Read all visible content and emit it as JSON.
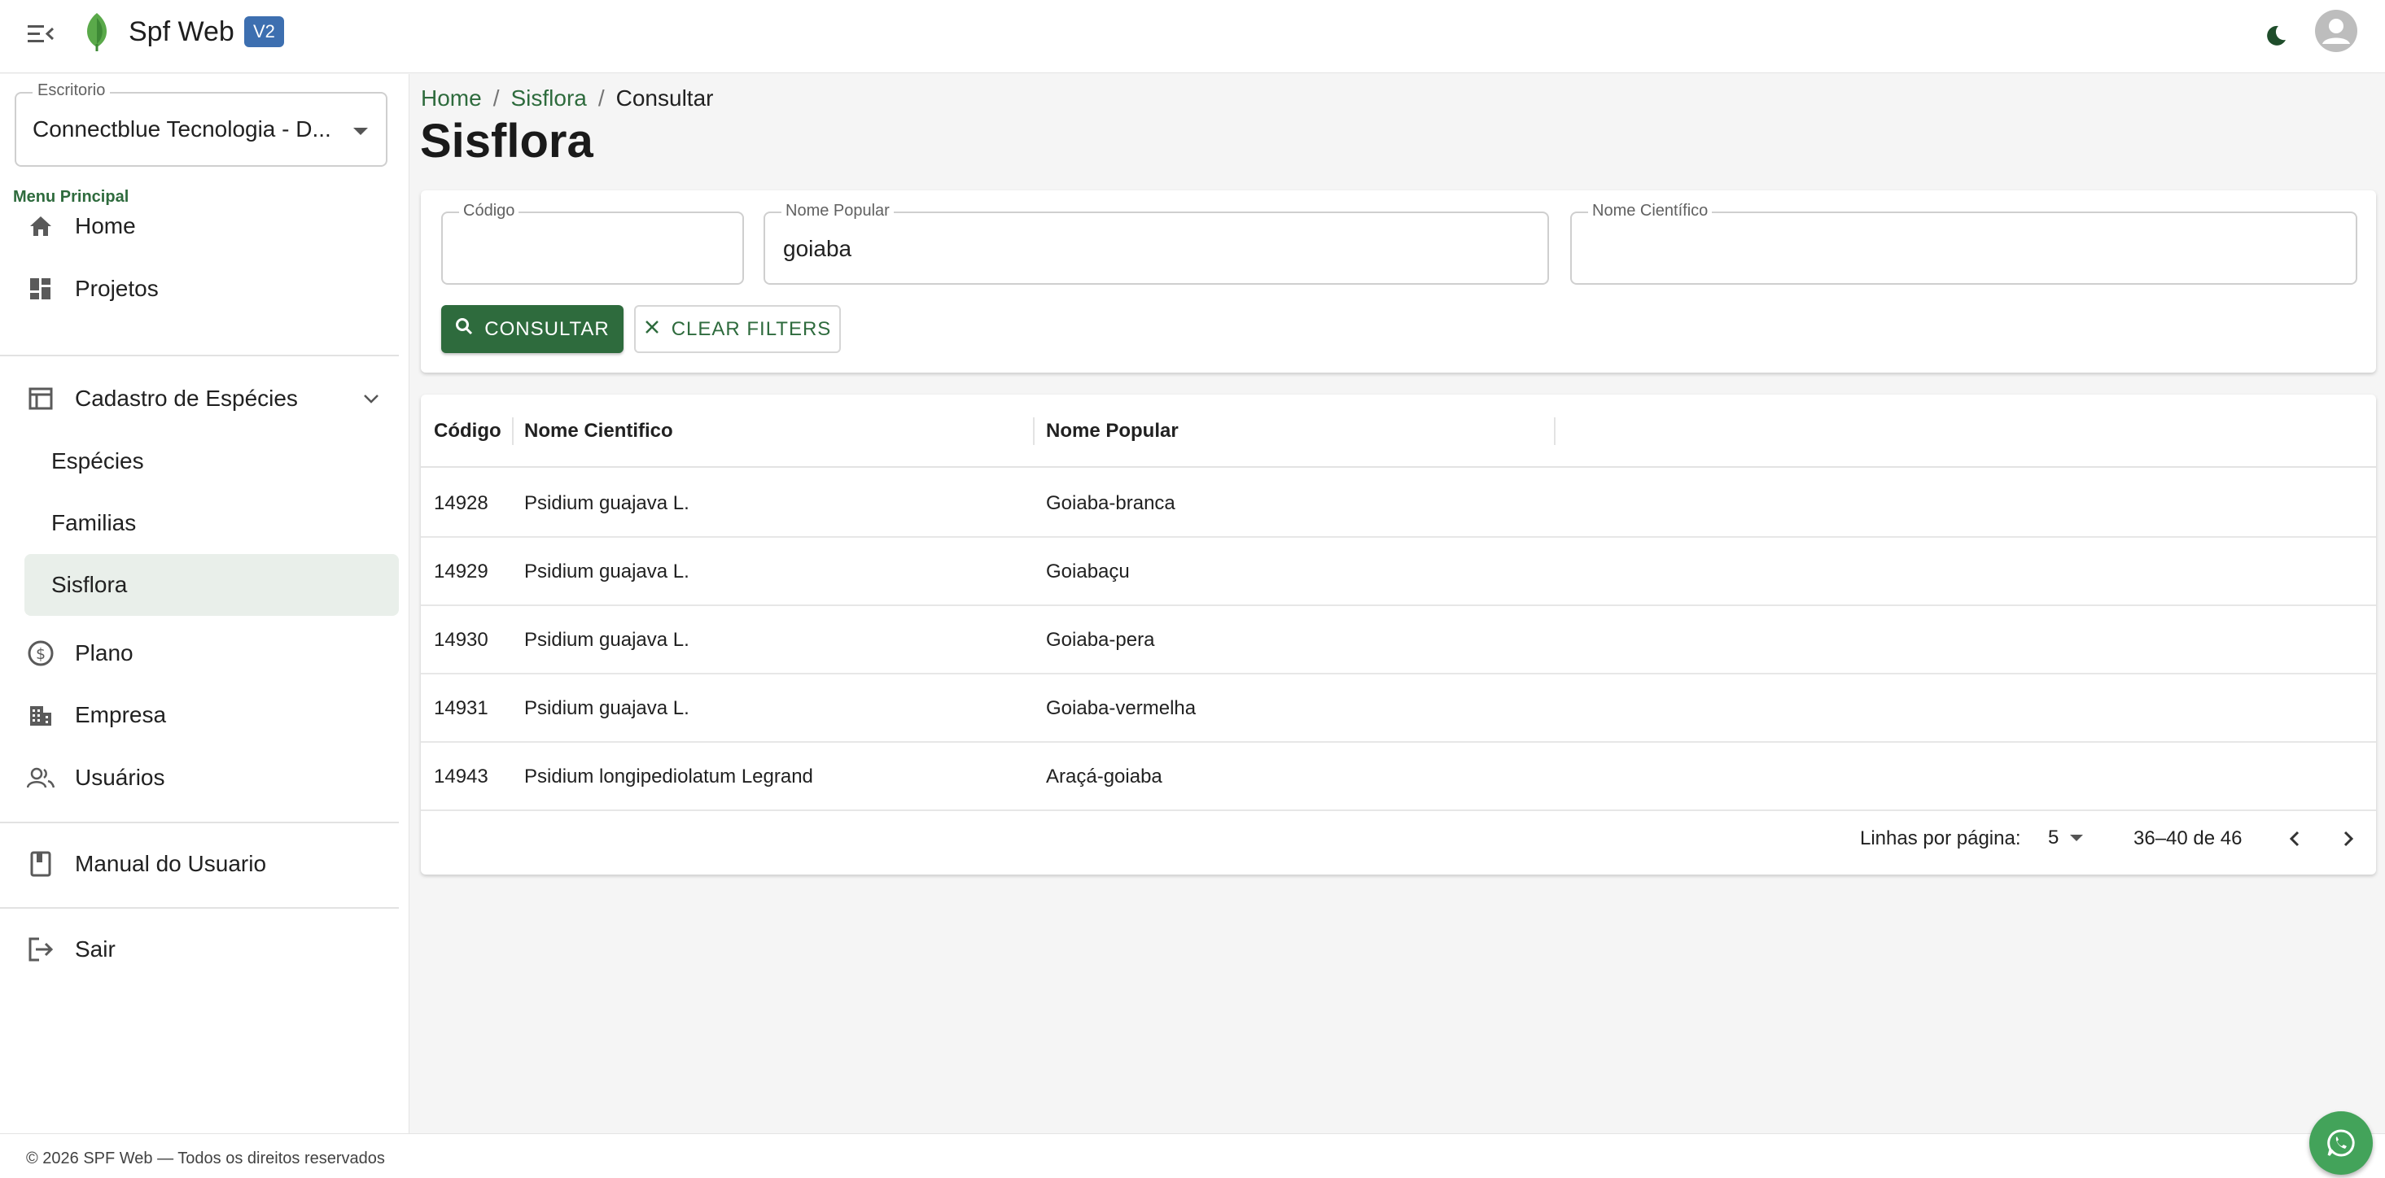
{
  "app": {
    "name": "Spf Web",
    "version_badge": "V2"
  },
  "sidebar": {
    "office_label": "Escritorio",
    "office_value": "Connectblue Tecnologia - D...",
    "section_title": "Menu Principal",
    "items": {
      "home": "Home",
      "projetos": "Projetos",
      "cadastro": "Cadastro de Espécies",
      "especies": "Espécies",
      "familias": "Familias",
      "sisflora": "Sisflora",
      "plano": "Plano",
      "empresa": "Empresa",
      "usuarios": "Usuários",
      "manual": "Manual do Usuario",
      "sair": "Sair"
    }
  },
  "breadcrumb": {
    "home": "Home",
    "section": "Sisflora",
    "current": "Consultar",
    "sep": "/"
  },
  "page_title": "Sisflora",
  "filters": {
    "codigo": {
      "label": "Código",
      "value": ""
    },
    "nome_popular": {
      "label": "Nome Popular",
      "value": "goiaba"
    },
    "nome_cientifico": {
      "label": "Nome Científico",
      "value": ""
    },
    "consultar_label": "CONSULTAR",
    "clear_label": "CLEAR FILTERS"
  },
  "table": {
    "headers": {
      "codigo": "Código",
      "nome_cientifico": "Nome Cientifico",
      "nome_popular": "Nome Popular"
    },
    "rows": [
      {
        "codigo": "14928",
        "nome_cientifico": "Psidium guajava L.",
        "nome_popular": "Goiaba-branca"
      },
      {
        "codigo": "14929",
        "nome_cientifico": "Psidium guajava L.",
        "nome_popular": "Goiabaçu"
      },
      {
        "codigo": "14930",
        "nome_cientifico": "Psidium guajava L.",
        "nome_popular": "Goiaba-pera"
      },
      {
        "codigo": "14931",
        "nome_cientifico": "Psidium guajava L.",
        "nome_popular": "Goiaba-vermelha"
      },
      {
        "codigo": "14943",
        "nome_cientifico": "Psidium longipediolatum Legrand",
        "nome_popular": "Araçá-goiaba"
      }
    ],
    "pagination": {
      "rows_label": "Linhas por página:",
      "rows_value": "5",
      "range": "36–40 de 46"
    }
  },
  "footer": {
    "text": "© 2026 SPF Web — Todos os direitos reservados"
  },
  "colors": {
    "primary": "#2e6b3d",
    "badge": "#3d6fb0",
    "whatsapp": "#43a35a"
  },
  "icons": [
    "menu-open-icon",
    "leaf-icon",
    "moon-icon",
    "user-avatar-icon",
    "home-icon",
    "dashboard-icon",
    "table-icon",
    "chevron-down-icon",
    "dollar-icon",
    "building-icon",
    "users-icon",
    "book-icon",
    "logout-icon",
    "search-icon",
    "close-icon",
    "chevron-left-icon",
    "chevron-right-icon",
    "whatsapp-icon"
  ]
}
